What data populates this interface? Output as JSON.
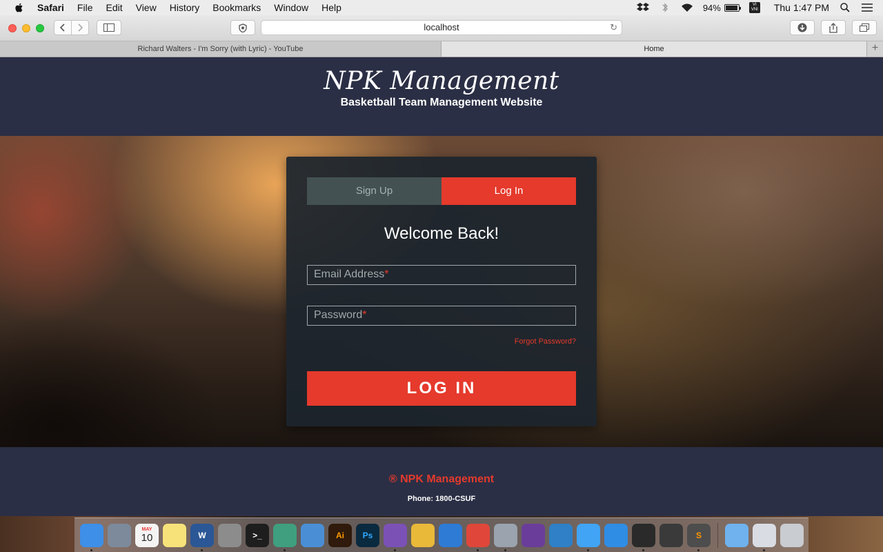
{
  "menubar": {
    "items": [
      "Safari",
      "File",
      "Edit",
      "View",
      "History",
      "Bookmarks",
      "Window",
      "Help"
    ],
    "battery": "94%",
    "clock": "Thu 1:47 PM",
    "input_method": "VI\nVNI"
  },
  "toolbar": {
    "address": "localhost"
  },
  "tabs": [
    {
      "label": "Richard Walters - I'm Sorry (with Lyric) - YouTube"
    },
    {
      "label": "Home"
    }
  ],
  "site": {
    "title": "NPK Management",
    "subtitle": "Basketball Team Management Website"
  },
  "form": {
    "tab_signup": "Sign Up",
    "tab_login": "Log In",
    "heading": "Welcome Back!",
    "email_placeholder": "Email Address",
    "password_placeholder": "Password",
    "required_mark": "*",
    "forgot": "Forgot Password?",
    "submit": "LOG IN"
  },
  "footer": {
    "brand": "® NPK Management",
    "phone": "Phone: 1800-CSUF"
  },
  "dock": {
    "calendar_month": "MAY",
    "calendar_day": "10",
    "items": [
      {
        "name": "finder-icon",
        "color": "#3d8fe8",
        "label": ""
      },
      {
        "name": "launchpad-icon",
        "color": "#7c8a9c",
        "label": ""
      },
      {
        "name": "calendar-icon",
        "color": "#f4f4f4",
        "label": ""
      },
      {
        "name": "notes-icon",
        "color": "#f7e27a",
        "label": ""
      },
      {
        "name": "word-icon",
        "color": "#2b5796",
        "label": "W"
      },
      {
        "name": "system-preferences-icon",
        "color": "#8c8c8c",
        "label": ""
      },
      {
        "name": "terminal-icon",
        "color": "#1e1e1e",
        "label": ">_"
      },
      {
        "name": "atom-icon",
        "color": "#3f9f7f",
        "label": ""
      },
      {
        "name": "time-machine-icon",
        "color": "#4a8fd6",
        "label": ""
      },
      {
        "name": "illustrator-icon",
        "color": "#2f1a0b",
        "label": "Ai"
      },
      {
        "name": "photoshop-icon",
        "color": "#0a2a3f",
        "label": "Ps"
      },
      {
        "name": "viber-icon",
        "color": "#7b51b6",
        "label": ""
      },
      {
        "name": "cyberduck-icon",
        "color": "#e9b93a",
        "label": ""
      },
      {
        "name": "xcode-icon",
        "color": "#2e7bd6",
        "label": ""
      },
      {
        "name": "chrome-icon",
        "color": "#e0473a",
        "label": ""
      },
      {
        "name": "settings-icon",
        "color": "#9aa3ae",
        "label": ""
      },
      {
        "name": "github-desktop-icon",
        "color": "#6a3d9a",
        "label": ""
      },
      {
        "name": "sourcetree-icon",
        "color": "#2f80c6",
        "label": ""
      },
      {
        "name": "messages-icon",
        "color": "#41a4f4",
        "label": ""
      },
      {
        "name": "safari-icon",
        "color": "#2f8de4",
        "label": ""
      },
      {
        "name": "final-cut-icon",
        "color": "#2a2a2a",
        "label": ""
      },
      {
        "name": "unity-icon",
        "color": "#3a3a3a",
        "label": ""
      },
      {
        "name": "sublime-text-icon",
        "color": "#4d4d4d",
        "label": "S"
      },
      {
        "name": "folder-icon",
        "color": "#6fb2ee",
        "label": ""
      },
      {
        "name": "downloads-icon",
        "color": "#d9dde3",
        "label": ""
      },
      {
        "name": "trash-icon",
        "color": "#c9ccd1",
        "label": ""
      }
    ]
  }
}
